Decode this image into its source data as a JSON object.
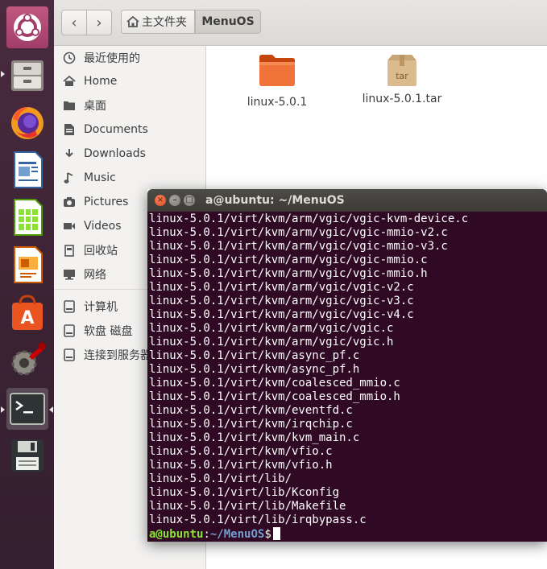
{
  "file_manager": {
    "breadcrumb": {
      "home": "主文件夹",
      "current": "MenuOS"
    },
    "sidebar": {
      "places": [
        {
          "label": "最近使用的",
          "icon": "clock-icon"
        },
        {
          "label": "Home",
          "icon": "home-icon"
        },
        {
          "label": "桌面",
          "icon": "folder-icon"
        },
        {
          "label": "Documents",
          "icon": "document-icon"
        },
        {
          "label": "Downloads",
          "icon": "download-icon"
        },
        {
          "label": "Music",
          "icon": "music-icon"
        },
        {
          "label": "Pictures",
          "icon": "camera-icon"
        },
        {
          "label": "Videos",
          "icon": "video-icon"
        },
        {
          "label": "回收站",
          "icon": "trash-icon"
        },
        {
          "label": "网络",
          "icon": "network-icon"
        }
      ],
      "devices": [
        {
          "label": "计算机",
          "icon": "drive-icon"
        },
        {
          "label": "软盘 磁盘",
          "icon": "floppy-icon"
        },
        {
          "label": "连接到服务器",
          "icon": "server-icon"
        }
      ]
    },
    "files": [
      {
        "name": "linux-5.0.1",
        "icon": "folder-icon"
      },
      {
        "name": "linux-5.0.1.tar",
        "icon": "tar-archive-icon",
        "badge": "tar"
      }
    ]
  },
  "terminal": {
    "title": "a@ubuntu: ~/MenuOS",
    "lines": [
      "linux-5.0.1/virt/kvm/arm/vgic/vgic-kvm-device.c",
      "linux-5.0.1/virt/kvm/arm/vgic/vgic-mmio-v2.c",
      "linux-5.0.1/virt/kvm/arm/vgic/vgic-mmio-v3.c",
      "linux-5.0.1/virt/kvm/arm/vgic/vgic-mmio.c",
      "linux-5.0.1/virt/kvm/arm/vgic/vgic-mmio.h",
      "linux-5.0.1/virt/kvm/arm/vgic/vgic-v2.c",
      "linux-5.0.1/virt/kvm/arm/vgic/vgic-v3.c",
      "linux-5.0.1/virt/kvm/arm/vgic/vgic-v4.c",
      "linux-5.0.1/virt/kvm/arm/vgic/vgic.c",
      "linux-5.0.1/virt/kvm/arm/vgic/vgic.h",
      "linux-5.0.1/virt/kvm/async_pf.c",
      "linux-5.0.1/virt/kvm/async_pf.h",
      "linux-5.0.1/virt/kvm/coalesced_mmio.c",
      "linux-5.0.1/virt/kvm/coalesced_mmio.h",
      "linux-5.0.1/virt/kvm/eventfd.c",
      "linux-5.0.1/virt/kvm/irqchip.c",
      "linux-5.0.1/virt/kvm/kvm_main.c",
      "linux-5.0.1/virt/kvm/vfio.c",
      "linux-5.0.1/virt/kvm/vfio.h",
      "linux-5.0.1/virt/lib/",
      "linux-5.0.1/virt/lib/Kconfig",
      "linux-5.0.1/virt/lib/Makefile",
      "linux-5.0.1/virt/lib/irqbypass.c"
    ],
    "prompt": {
      "user": "a@ubuntu",
      "sep": ":",
      "path": "~/MenuOS",
      "symbol": "$"
    }
  },
  "launcher": {
    "items": [
      {
        "name": "ubuntu-dash-icon"
      },
      {
        "name": "files-icon"
      },
      {
        "name": "firefox-icon"
      },
      {
        "name": "writer-icon"
      },
      {
        "name": "calc-icon"
      },
      {
        "name": "impress-icon"
      },
      {
        "name": "software-center-icon"
      },
      {
        "name": "system-settings-icon"
      },
      {
        "name": "terminal-icon"
      },
      {
        "name": "floppy-save-icon"
      }
    ]
  },
  "colors": {
    "terminal_bg": "#300a24",
    "prompt_user": "#8ae234",
    "prompt_path": "#729fcf",
    "launcher_bg": "#3a2233",
    "close_button": "#df4a16"
  }
}
